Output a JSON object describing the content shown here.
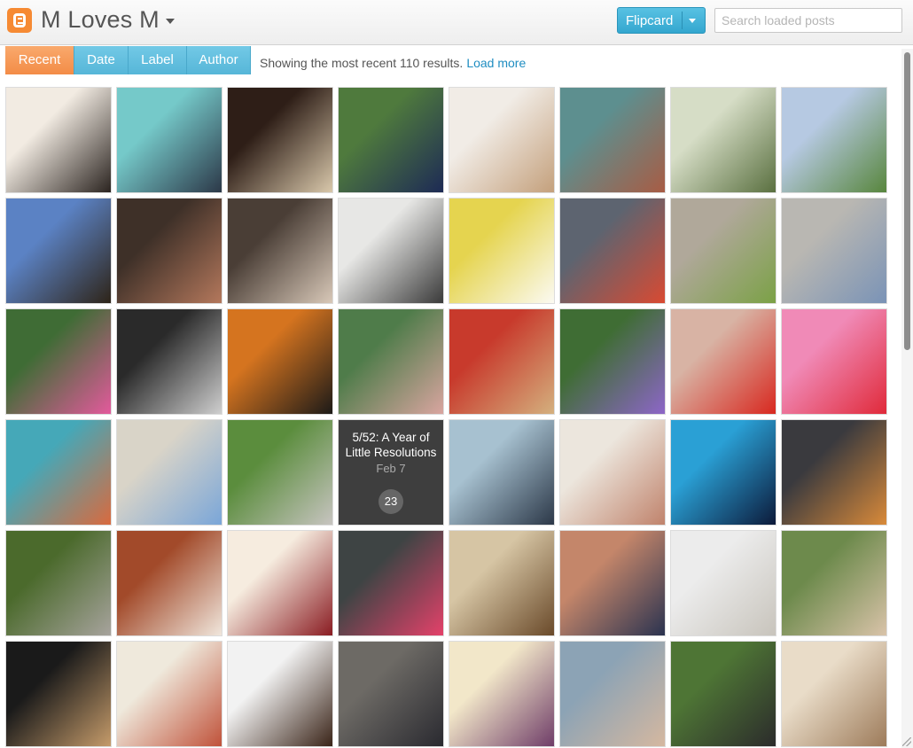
{
  "header": {
    "blog_title": "M Loves M",
    "view_selector": "Flipcard",
    "search_placeholder": "Search loaded posts"
  },
  "tabs": [
    {
      "label": "Recent",
      "active": true
    },
    {
      "label": "Date",
      "active": false
    },
    {
      "label": "Label",
      "active": false
    },
    {
      "label": "Author",
      "active": false
    }
  ],
  "status": {
    "text": "Showing the most recent 110 results.",
    "load_more": "Load more"
  },
  "featured_post": {
    "title": "5/52: A Year of Little Resolutions",
    "date": "Feb 7",
    "comment_count": "23"
  },
  "colors": {
    "accent_blue": "#56b6d8",
    "active_orange": "#f38c47",
    "logo_orange": "#f68a33"
  },
  "tiles": [
    {
      "name": "couple-kiss-photo",
      "colors": [
        "#f2ebe2",
        "#2b2420"
      ]
    },
    {
      "name": "woman-turquoise-wall-photo",
      "colors": [
        "#75c9c9",
        "#2c3848"
      ]
    },
    {
      "name": "dog-photo",
      "colors": [
        "#2e1e17",
        "#d9c8ab"
      ]
    },
    {
      "name": "woman-park-bench-photo",
      "colors": [
        "#4f7a3d",
        "#1d2a55"
      ]
    },
    {
      "name": "gold-sandal-photo",
      "colors": [
        "#f1ece6",
        "#c4a07c"
      ]
    },
    {
      "name": "woman-brick-street-photo",
      "colors": [
        "#5d8f8f",
        "#a85c44"
      ]
    },
    {
      "name": "salad-wrap-photo",
      "colors": [
        "#d6ddc6",
        "#5a7040"
      ]
    },
    {
      "name": "woman-field-photo",
      "colors": [
        "#b6c9e2",
        "#58863d"
      ]
    },
    {
      "name": "ponte-vecchio-photo",
      "colors": [
        "#5b82c4",
        "#2e2418"
      ]
    },
    {
      "name": "couple-selfie-photo",
      "colors": [
        "#3e3028",
        "#b4785c"
      ]
    },
    {
      "name": "couple-drink-photo",
      "colors": [
        "#4a3e36",
        "#d8c8b8"
      ]
    },
    {
      "name": "pendant-lamp-photo",
      "colors": [
        "#e7e7e5",
        "#3a3a3a"
      ]
    },
    {
      "name": "coconut-cake-photo",
      "colors": [
        "#e5d44f",
        "#fbfaf2"
      ]
    },
    {
      "name": "woman-red-jacket-photo",
      "colors": [
        "#5d6470",
        "#d94a32"
      ]
    },
    {
      "name": "woman-green-dress-collage-photo",
      "colors": [
        "#b0a89a",
        "#7ba146"
      ]
    },
    {
      "name": "woman-street-cafe-photo",
      "colors": [
        "#b9b7b2",
        "#7a93b6"
      ]
    },
    {
      "name": "pink-tulips-photo",
      "colors": [
        "#3f6c35",
        "#e35a9c"
      ]
    },
    {
      "name": "woman-black-white-portrait-photo",
      "colors": [
        "#2a2a2a",
        "#cfcfcf"
      ]
    },
    {
      "name": "heart-cookies-photo",
      "colors": [
        "#d5741f",
        "#1c1a18"
      ]
    },
    {
      "name": "woman-pink-skirt-photo",
      "colors": [
        "#4f7c4a",
        "#d9a5a0"
      ]
    },
    {
      "name": "basketball-court-photo",
      "colors": [
        "#c83a2c",
        "#d4b07e"
      ]
    },
    {
      "name": "woman-purple-top-photo",
      "colors": [
        "#3f6d34",
        "#8d66c8"
      ]
    },
    {
      "name": "red-heart-blinds-photo",
      "colors": [
        "#d8b3a4",
        "#d8281f"
      ]
    },
    {
      "name": "valentine-crafts-photo",
      "colors": [
        "#f08ab7",
        "#e02a3a"
      ]
    },
    {
      "name": "woman-mural-photo",
      "colors": [
        "#45a8b8",
        "#d96a3e"
      ]
    },
    {
      "name": "building-facade-photo",
      "colors": [
        "#d9d4c8",
        "#7aa6d8"
      ]
    },
    {
      "name": "woman-path-photo",
      "colors": [
        "#5b8d3d",
        "#c7c4c0"
      ]
    },
    {
      "name": "featured-post-tile",
      "colors": [
        "#3e3e3e",
        "#3e3e3e"
      ]
    },
    {
      "name": "woman-striped-shirt-photo",
      "colors": [
        "#a7c1d0",
        "#2c3848"
      ]
    },
    {
      "name": "dress-mannequins-photo",
      "colors": [
        "#ece6dd",
        "#c0836c"
      ]
    },
    {
      "name": "ferris-wheel-pier-photo",
      "colors": [
        "#2aa0d5",
        "#0c1a3a"
      ]
    },
    {
      "name": "chalkboard-pizza-photo",
      "colors": [
        "#3a3a3e",
        "#d98a3a"
      ]
    },
    {
      "name": "dirt-road-photo",
      "colors": [
        "#4b6a2c",
        "#a7a39d"
      ]
    },
    {
      "name": "woman-wood-wall-photo",
      "colors": [
        "#a24a2a",
        "#f0e6dc"
      ]
    },
    {
      "name": "cake-apples-photo",
      "colors": [
        "#f6ecdf",
        "#8a1c22"
      ]
    },
    {
      "name": "woman-pink-blouse-photo",
      "colors": [
        "#3e4444",
        "#e4416a"
      ]
    },
    {
      "name": "vintage-books-photo",
      "colors": [
        "#d6c5a4",
        "#6a4a2a"
      ]
    },
    {
      "name": "woman-brick-wall-photo",
      "colors": [
        "#c4866a",
        "#2b3350"
      ]
    },
    {
      "name": "wedding-gowns-photo",
      "colors": [
        "#ececec",
        "#c8c4bc"
      ]
    },
    {
      "name": "woman-hedge-photo",
      "colors": [
        "#6d8a4c",
        "#d9c3a9"
      ]
    },
    {
      "name": "red-carpet-photo",
      "colors": [
        "#1a1a1a",
        "#c59b6a"
      ]
    },
    {
      "name": "book-cover-photo",
      "colors": [
        "#efe9dc",
        "#c0523a"
      ]
    },
    {
      "name": "chocolate-cookies-photo",
      "colors": [
        "#f2f2f2",
        "#3a2418"
      ]
    },
    {
      "name": "woman-dark-floral-photo",
      "colors": [
        "#6d6a65",
        "#2a2a30"
      ]
    },
    {
      "name": "picture-of-love-book-photo",
      "colors": [
        "#f2e7c9",
        "#6f3d68"
      ]
    },
    {
      "name": "friends-restaurant-photo",
      "colors": [
        "#8ca3b5",
        "#d5b8a0"
      ]
    },
    {
      "name": "woman-stripes-garden-photo",
      "colors": [
        "#4e7535",
        "#2b2b2b"
      ]
    },
    {
      "name": "carved-flower-photo",
      "colors": [
        "#e9dcc8",
        "#9d7b5a"
      ]
    }
  ]
}
